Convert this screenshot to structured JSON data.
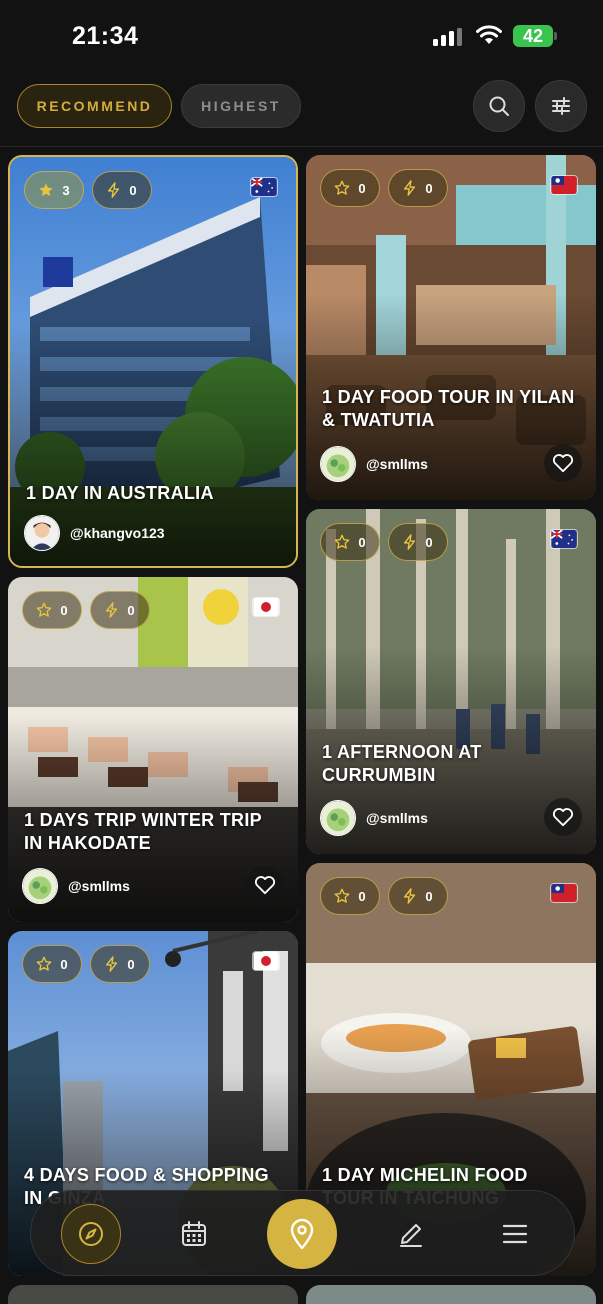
{
  "status_bar": {
    "time": "21:34",
    "battery": "42"
  },
  "header": {
    "tabs": [
      {
        "label": "RECOMMEND",
        "active": true
      },
      {
        "label": "HIGHEST",
        "active": false
      }
    ],
    "icons": [
      "search-icon",
      "filter-sliders-icon"
    ]
  },
  "cards": [
    {
      "title": "1 DAY IN AUSTRALIA",
      "author": "@khangvo123",
      "stars": "3",
      "bolts": "0",
      "flag": "australia"
    },
    {
      "title": "1 DAY FOOD TOUR IN YILAN & TWATUTIA",
      "author": "@smllms",
      "stars": "0",
      "bolts": "0",
      "flag": "taiwan"
    },
    {
      "title": "1 AFTERNOON AT CURRUMBIN",
      "author": "@smllms",
      "stars": "0",
      "bolts": "0",
      "flag": "australia"
    },
    {
      "title": "1 DAYS TRIP WINTER TRIP IN HAKODATE",
      "author": "@smllms",
      "stars": "0",
      "bolts": "0",
      "flag": "japan"
    },
    {
      "title": "4 DAYS FOOD & SHOPPING IN GINZA",
      "stars": "0",
      "bolts": "0",
      "flag": "japan"
    },
    {
      "title": "1 DAY MICHELIN FOOD TOUR IN TAICHUNG",
      "stars": "0",
      "bolts": "0",
      "flag": "taiwan"
    }
  ],
  "nav": [
    "compass-icon",
    "calendar-icon",
    "map-pin-icon",
    "pencil-icon",
    "menu-icon"
  ],
  "colors": {
    "accent": "#d6b442",
    "background": "#121212"
  }
}
